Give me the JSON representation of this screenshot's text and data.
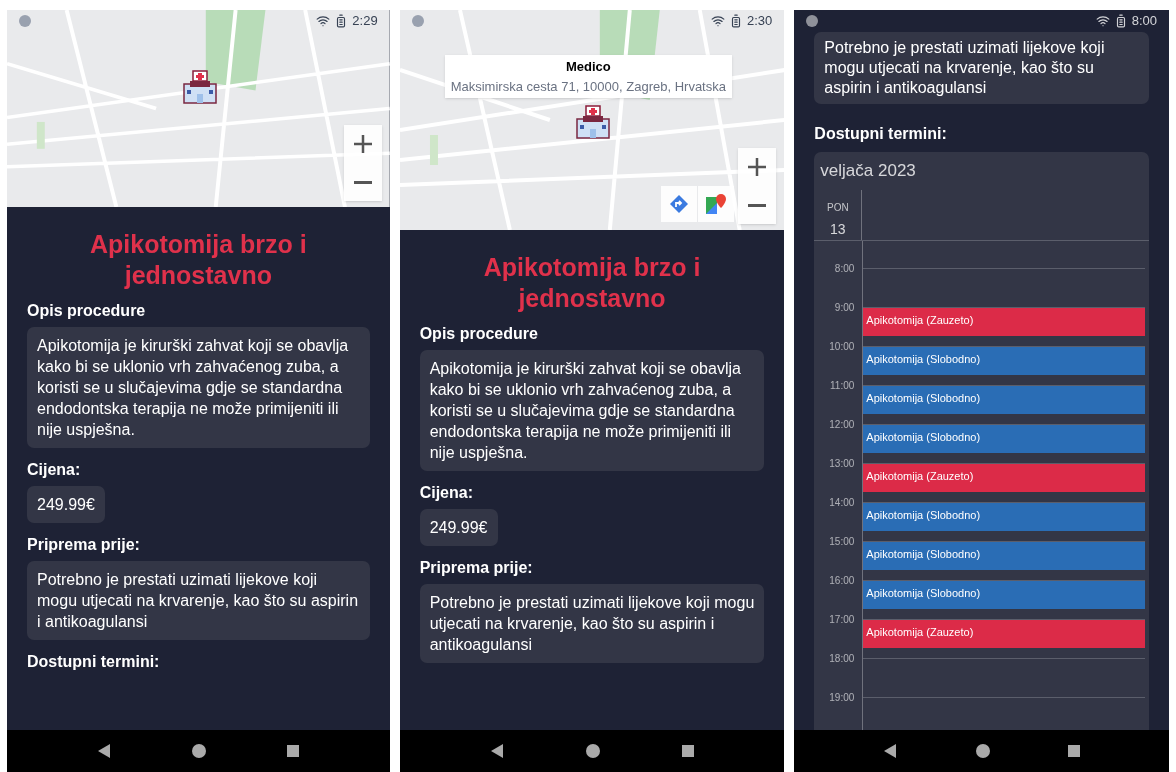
{
  "screens": [
    {
      "kind": "detail",
      "status_time": "2:29",
      "map": {
        "extra_buttons": false
      },
      "title": "Apikotomija brzo i jednostavno",
      "sections": [
        {
          "heading": "Opis procedure",
          "body": "Apikotomija je kirurški zahvat koji se obavlja kako bi se uklonio vrh zahvaćenog zuba, a koristi se u slučajevima gdje se standardna endodontska terapija ne može primijeniti ili nije uspješna."
        },
        {
          "heading": "Cijena:",
          "body": "249.99€"
        },
        {
          "heading": "Priprema prije:",
          "body": "Potrebno je prestati uzimati lijekove koji mogu utjecati na krvarenje, kao što su aspirin i antikoagulansi"
        },
        {
          "heading": "Dostupni termini:"
        }
      ]
    },
    {
      "kind": "detail",
      "status_time": "2:30",
      "map": {
        "info_window": {
          "title": "Medico",
          "address": "Maksimirska cesta 71, 10000, Zagreb, Hrvatska"
        },
        "extra_buttons": true
      },
      "title": "Apikotomija brzo i jednostavno",
      "sections": [
        {
          "heading": "Opis procedure",
          "body": "Apikotomija je kirurški zahvat koji se obavlja kako bi se uklonio vrh zahvaćenog zuba, a koristi se u slučajevima gdje se standardna endodontska terapija ne može primijeniti ili nije uspješna."
        },
        {
          "heading": "Cijena:",
          "body": "249.99€"
        },
        {
          "heading": "Priprema prije:",
          "body": "Potrebno je prestati uzimati lijekove koji mogu utjecati na krvarenje, kao što su aspirin i antikoagulansi"
        }
      ]
    },
    {
      "kind": "calendar",
      "status_time": "8:00",
      "top_card": "Potrebno je prestati uzimati lijekove koji mogu utjecati na krvarenje, kao što su aspirin i antikoagulansi",
      "heading": "Dostupni termini:",
      "month": "veljača 2023",
      "weekday": "PON",
      "day": "13",
      "slots": [
        {
          "time": "8:00"
        },
        {
          "time": "9:00",
          "event": {
            "label": "Apikotomija (Zauzeto)",
            "color": "#dc2b48"
          }
        },
        {
          "time": "10:00",
          "event": {
            "label": "Apikotomija (Slobodno)",
            "color": "#2a6db5"
          }
        },
        {
          "time": "11:00",
          "event": {
            "label": "Apikotomija (Slobodno)",
            "color": "#2a6db5"
          }
        },
        {
          "time": "12:00",
          "event": {
            "label": "Apikotomija (Slobodno)",
            "color": "#2a6db5"
          }
        },
        {
          "time": "13:00",
          "event": {
            "label": "Apikotomija (Zauzeto)",
            "color": "#dc2b48"
          }
        },
        {
          "time": "14:00",
          "event": {
            "label": "Apikotomija (Slobodno)",
            "color": "#2a6db5"
          }
        },
        {
          "time": "15:00",
          "event": {
            "label": "Apikotomija (Slobodno)",
            "color": "#2a6db5"
          }
        },
        {
          "time": "16:00",
          "event": {
            "label": "Apikotomija (Slobodno)",
            "color": "#2a6db5"
          }
        },
        {
          "time": "17:00",
          "event": {
            "label": "Apikotomija (Zauzeto)",
            "color": "#dc2b48"
          }
        },
        {
          "time": "18:00"
        },
        {
          "time": "19:00"
        }
      ]
    }
  ]
}
